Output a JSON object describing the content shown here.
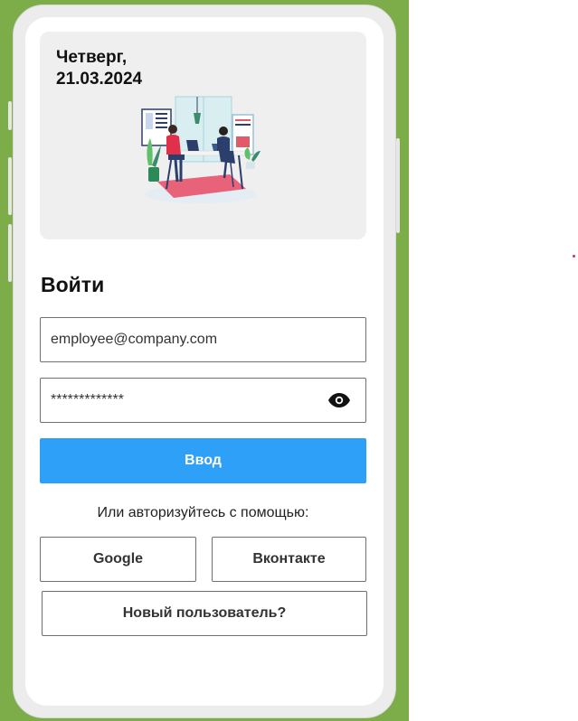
{
  "header": {
    "date_line1": "Четверг,",
    "date_line2": "21.03.2024"
  },
  "login": {
    "title": "Войти",
    "email_value": "employee@company.com",
    "password_value": "*************",
    "submit_label": "Ввод",
    "or_text": "Или авторизуйтесь с помощью:",
    "google_label": "Google",
    "vk_label": "Вконтакте",
    "new_user_label": "Новый пользователь?"
  },
  "colors": {
    "background": "#7cad48",
    "primary": "#2ea0f8",
    "card": "#efefef"
  },
  "icons": {
    "password_toggle": "eye-icon",
    "illustration": "office-workers-illustration"
  }
}
